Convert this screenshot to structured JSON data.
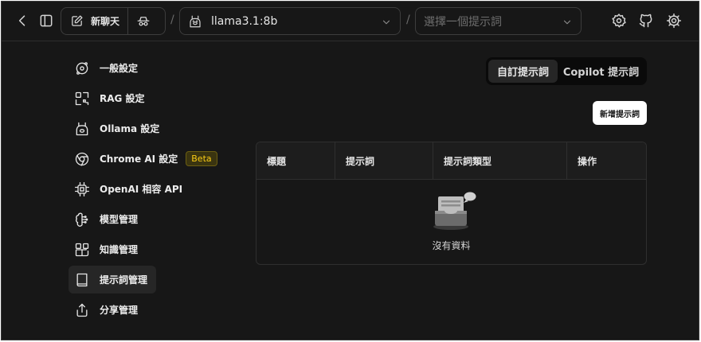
{
  "topbar": {
    "new_chat_label": "新聊天",
    "model_name": "llama3.1:8b",
    "prompt_placeholder": "選擇一個提示詞",
    "separator": "/"
  },
  "sidebar": {
    "items": [
      {
        "label": "一般設定",
        "icon": "gear-orbit-icon"
      },
      {
        "label": "RAG 設定",
        "icon": "rag-icon"
      },
      {
        "label": "Ollama 設定",
        "icon": "ollama-llama-icon"
      },
      {
        "label": "Chrome AI 設定",
        "icon": "chrome-icon",
        "badge": "Beta"
      },
      {
        "label": "OpenAI 相容 API",
        "icon": "cpu-chip-icon"
      },
      {
        "label": "模型管理",
        "icon": "brain-icon"
      },
      {
        "label": "知識管理",
        "icon": "blocks-icon"
      },
      {
        "label": "提示詞管理",
        "icon": "book-icon",
        "active": true
      },
      {
        "label": "分享管理",
        "icon": "share-icon"
      }
    ]
  },
  "main": {
    "tabs": [
      {
        "label": "自訂提示詞",
        "active": true
      },
      {
        "label": "Copilot 提示詞",
        "active": false
      }
    ],
    "add_button": "新增提示詞",
    "table": {
      "columns": [
        "標題",
        "提示詞",
        "提示詞類型",
        "操作"
      ],
      "empty_text": "沒有資料"
    }
  },
  "colors": {
    "background": "#171717",
    "badge": "#facc15",
    "primary_button": "#ffffff"
  }
}
